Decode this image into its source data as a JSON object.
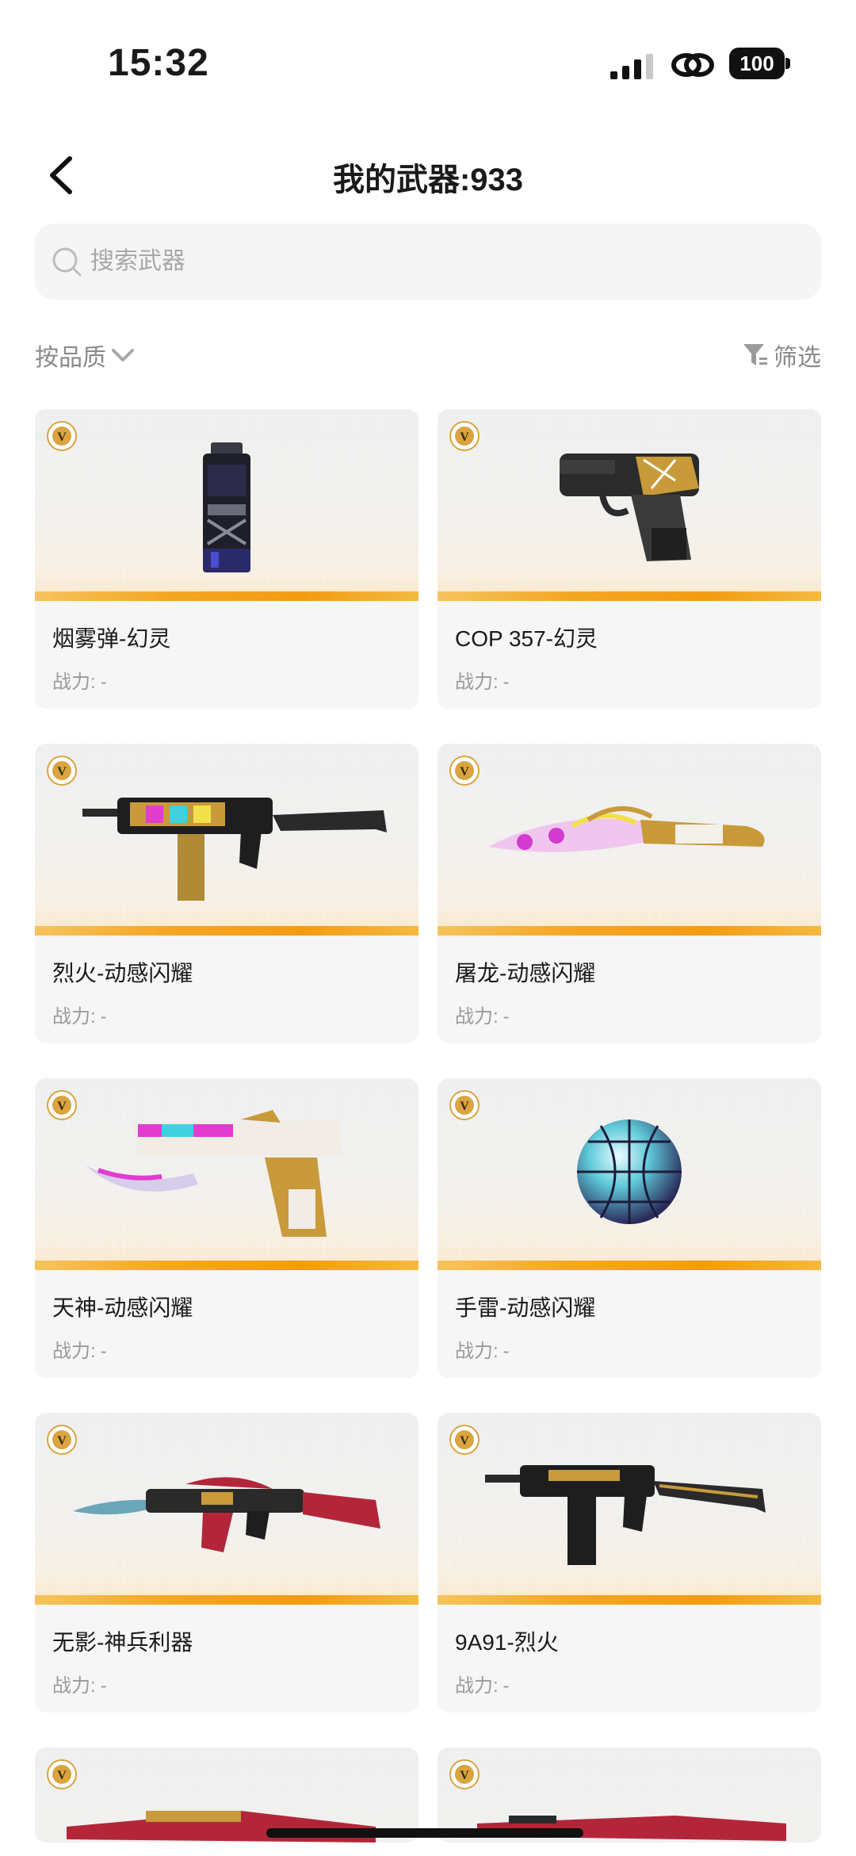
{
  "status_bar": {
    "time": "15:32",
    "battery": "100"
  },
  "header": {
    "title": "我的武器:933"
  },
  "search": {
    "placeholder": "搜索武器"
  },
  "toolbar": {
    "sort_label": "按品质",
    "filter_label": "筛选"
  },
  "colors": {
    "accent_gold": "#f4a623",
    "badge_gold": "#d9a441"
  },
  "weapons": [
    {
      "name": "烟雾弹-幻灵",
      "power_label": "战力:",
      "power_value": "-",
      "icon": "smoke-grenade-icon"
    },
    {
      "name": "COP 357-幻灵",
      "power_label": "战力:",
      "power_value": "-",
      "icon": "pistol-icon"
    },
    {
      "name": "烈火-动感闪耀",
      "power_label": "战力:",
      "power_value": "-",
      "icon": "smg-icon"
    },
    {
      "name": "屠龙-动感闪耀",
      "power_label": "战力:",
      "power_value": "-",
      "icon": "knife-icon"
    },
    {
      "name": "天神-动感闪耀",
      "power_label": "战力:",
      "power_value": "-",
      "icon": "desert-eagle-icon"
    },
    {
      "name": "手雷-动感闪耀",
      "power_label": "战力:",
      "power_value": "-",
      "icon": "disco-grenade-icon"
    },
    {
      "name": "无影-神兵利器",
      "power_label": "战力:",
      "power_value": "-",
      "icon": "rifle-blade-icon"
    },
    {
      "name": "9A91-烈火",
      "power_label": "战力:",
      "power_value": "-",
      "icon": "smg-icon"
    }
  ]
}
